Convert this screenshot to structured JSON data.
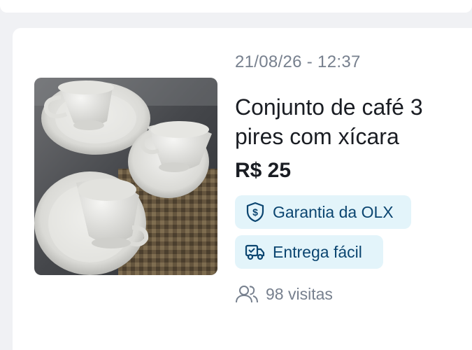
{
  "listing": {
    "date": "21/08/26 - 12:37",
    "title": "Conjunto de café 3 pires com xícara",
    "price": "R$ 25",
    "badges": [
      {
        "label": "Garantia da OLX",
        "icon": "shield-dollar-icon"
      },
      {
        "label": "Entrega fácil",
        "icon": "delivery-truck-icon"
      }
    ],
    "visits": "98 visitas",
    "visits_icon": "users-icon"
  },
  "colors": {
    "badge_background": "#e3f4fa",
    "badge_text": "#0b4570",
    "muted_text": "#77808e",
    "primary_text": "#1a1d23"
  }
}
